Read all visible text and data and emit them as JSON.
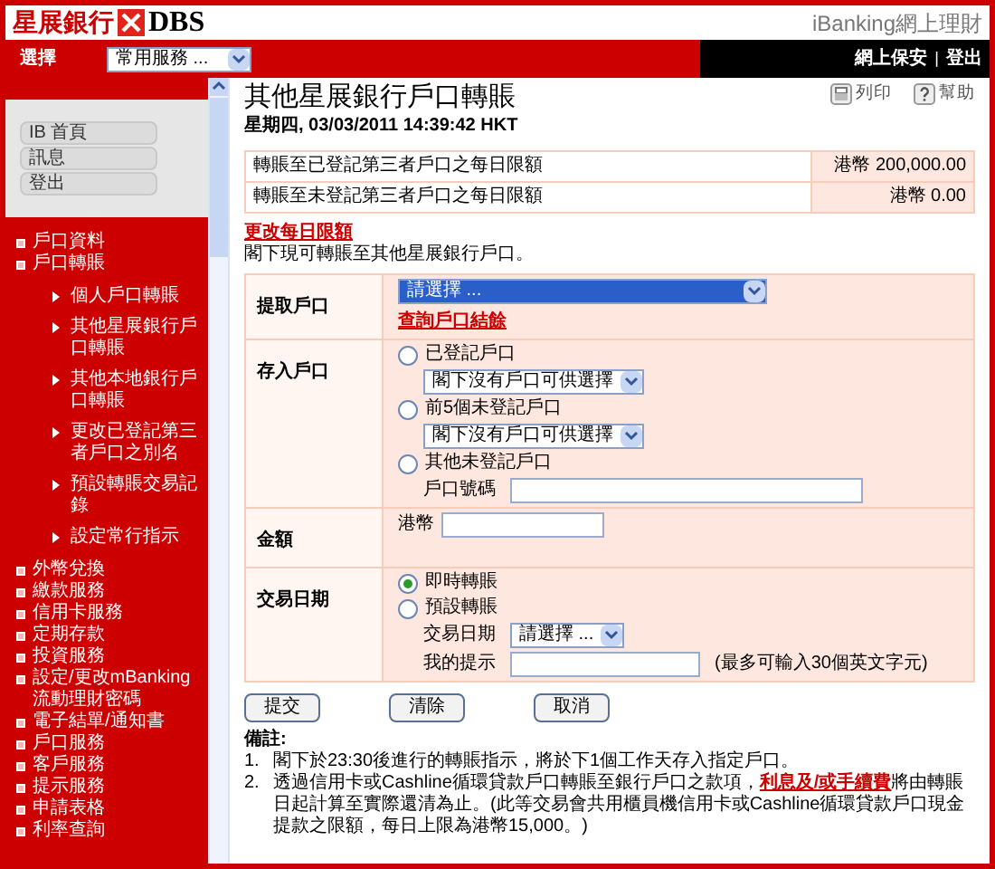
{
  "header": {
    "logo_text": "星展銀行",
    "logo_brand": "DBS",
    "product": "iBanking網上理財"
  },
  "nav": {
    "select_label": "選擇",
    "select_value": "常用服務 ...",
    "links": [
      "網上保安",
      "登出"
    ],
    "separator": "|"
  },
  "sidebar": {
    "buttons": [
      "IB 首頁",
      "訊息",
      "登出"
    ],
    "items": [
      {
        "label": "戶口資料"
      },
      {
        "label": "戶口轉賬",
        "children": [
          {
            "label": "個人戶口轉賬"
          },
          {
            "label": "其他星展銀行戶口轉賬"
          },
          {
            "label": "其他本地銀行戶口轉賬"
          },
          {
            "label": "更改已登記第三者戶口之別名"
          },
          {
            "label": "預設轉賬交易記錄"
          },
          {
            "label": "設定常行指示"
          }
        ]
      },
      {
        "label": "外幣兌換"
      },
      {
        "label": "繳款服務"
      },
      {
        "label": "信用卡服務"
      },
      {
        "label": "定期存款"
      },
      {
        "label": "投資服務"
      },
      {
        "label": "設定/更改mBanking流動理財密碼"
      },
      {
        "label": "電子結單/通知書"
      },
      {
        "label": "戶口服務"
      },
      {
        "label": "客戶服務"
      },
      {
        "label": "提示服務"
      },
      {
        "label": "申請表格"
      },
      {
        "label": "利率查詢"
      }
    ]
  },
  "toolbar": [
    {
      "kind": "print",
      "label": "列印"
    },
    {
      "kind": "help",
      "label": "幫助"
    }
  ],
  "title": "其他星展銀行戶口轉賬",
  "date": "星期四, 03/03/2011 14:39:42 HKT",
  "limits": [
    {
      "label": "轉賬至已登記第三者戶口之每日限額",
      "value": "港幣 200,000.00"
    },
    {
      "label": "轉賬至未登記第三者戶口之每日限額",
      "value": "港幣 0.00"
    }
  ],
  "change_limit_link": "更改每日限額",
  "intro": "閣下現可轉賬至其他星展銀行戶口。",
  "form": [
    {
      "kind": "from",
      "label": "提取戶口",
      "select": "請選擇 ...",
      "highlighted": true,
      "link": "查詢戶口結餘"
    },
    {
      "kind": "to",
      "label": "存入戶口",
      "options": [
        {
          "label": "已登記戶口",
          "selected": false,
          "select": "閣下沒有戶口可供選擇"
        },
        {
          "label": "前5個未登記戶口",
          "selected": false,
          "select": "閣下沒有戶口可供選擇"
        },
        {
          "label": "其他未登記戶口",
          "selected": false,
          "field_label": "戶口號碼"
        }
      ]
    },
    {
      "kind": "amount",
      "label": "金額",
      "currency": "港幣"
    },
    {
      "kind": "date",
      "label": "交易日期",
      "options": [
        {
          "label": "即時轉賬",
          "selected": true
        },
        {
          "label": "預設轉賬",
          "selected": false
        }
      ],
      "date_label": "交易日期",
      "date_select": "請選擇 ...",
      "memo_label": "我的提示",
      "memo_hint": "(最多可輸入30個英文字元)"
    }
  ],
  "buttons": [
    "提交",
    "清除",
    "取消"
  ],
  "notes": {
    "title": "備註:",
    "items": [
      {
        "number": "1.",
        "text": "閣下於23:30後進行的轉賬指示，將於下1個工作天存入指定戶口。"
      },
      {
        "number": "2.",
        "text": "透過信用卡或Cashline循環貸款戶口轉賬至銀行戶口之款項，",
        "link": "利息及/或手續費",
        "text_after": "將由轉賬日起計算至實際還清為止。(此等交易會共用櫃員機信用卡或Cashline循環貸款戶口現金提款之限額，每日上限為港幣15,000。)"
      }
    ]
  }
}
